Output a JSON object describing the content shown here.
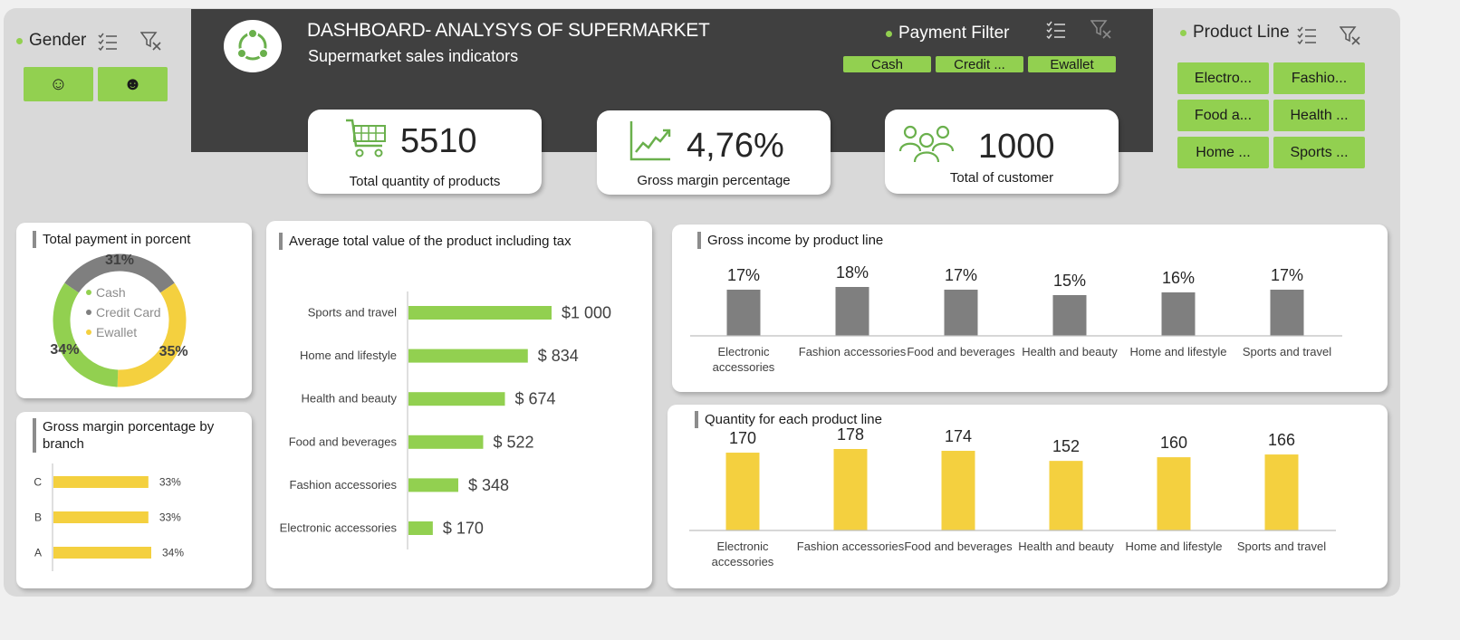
{
  "header": {
    "title": "DASHBOARD- ANALYSYS OF SUPERMARKET",
    "subtitle": "Supermarket sales indicators"
  },
  "slicers": {
    "gender": {
      "title": "Gender",
      "items": [
        "☺",
        "☻"
      ]
    },
    "payment": {
      "title": "Payment Filter",
      "items": [
        "Cash",
        "Credit ...",
        "Ewallet"
      ]
    },
    "product_line": {
      "title": "Product Line",
      "items": [
        "Electro...",
        "Fashio...",
        "Food a...",
        "Health ...",
        "Home ...",
        "Sports ..."
      ]
    }
  },
  "kpis": [
    {
      "value": "5510",
      "label": "Total quantity of products",
      "icon": "shopping-cart-icon"
    },
    {
      "value": "4,76%",
      "label": "Gross margin percentage",
      "icon": "line-growth-icon"
    },
    {
      "value": "1000",
      "label": "Total of customer",
      "icon": "people-icon"
    }
  ],
  "colors": {
    "green": "#92d050",
    "gray": "#7f7f7f",
    "yellow": "#f4d03f",
    "dark": "#404040"
  },
  "chart_data": [
    {
      "id": "payment",
      "type": "pie",
      "title": "Total payment in porcent",
      "categories": [
        "Cash",
        "Credit Card",
        "Ewallet"
      ],
      "values": [
        34,
        31,
        35
      ],
      "labels": [
        "34%",
        "31%",
        "35%"
      ],
      "colors": [
        "#92d050",
        "#7f7f7f",
        "#f4d03f"
      ]
    },
    {
      "id": "branch",
      "type": "bar",
      "orientation": "horizontal",
      "title": "Gross margin porcentage by branch",
      "categories": [
        "C",
        "B",
        "A"
      ],
      "values": [
        33,
        33,
        34
      ],
      "labels": [
        "33%",
        "33%",
        "34%"
      ],
      "color": "#f4d03f"
    },
    {
      "id": "avgvalue",
      "type": "bar",
      "orientation": "horizontal",
      "title": "Average total value of the product including tax",
      "categories": [
        "Sports and travel",
        "Home and lifestyle",
        "Health and beauty",
        "Food and beverages",
        "Fashion accessories",
        "Electronic accessories"
      ],
      "values": [
        1000,
        834,
        674,
        522,
        348,
        170
      ],
      "labels": [
        "$1 000",
        "$ 834",
        "$ 674",
        "$ 522",
        "$ 348",
        "$ 170"
      ],
      "color": "#92d050"
    },
    {
      "id": "income",
      "type": "bar",
      "title": "Gross income by product line",
      "categories": [
        "Electronic accessories",
        "Fashion accessories",
        "Food and beverages",
        "Health and beauty",
        "Home and lifestyle",
        "Sports and travel"
      ],
      "values": [
        17,
        18,
        17,
        15,
        16,
        17
      ],
      "labels": [
        "17%",
        "18%",
        "17%",
        "15%",
        "16%",
        "17%"
      ],
      "color": "#7f7f7f"
    },
    {
      "id": "quantity",
      "type": "bar",
      "title": "Quantity for each product line",
      "categories": [
        "Electronic accessories",
        "Fashion accessories",
        "Food and beverages",
        "Health and beauty",
        "Home and lifestyle",
        "Sports and travel"
      ],
      "values": [
        170,
        178,
        174,
        152,
        160,
        166
      ],
      "labels": [
        "170",
        "178",
        "174",
        "152",
        "160",
        "166"
      ],
      "color": "#f4d03f"
    }
  ]
}
